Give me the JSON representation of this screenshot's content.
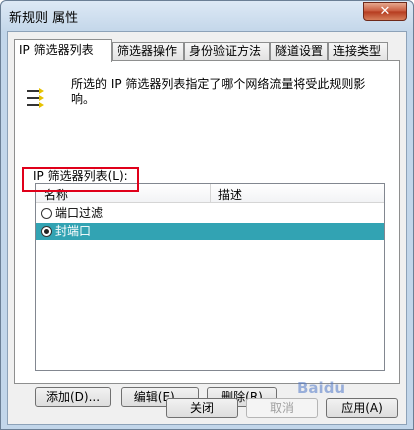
{
  "window": {
    "title": "新规则 属性",
    "close_label": "✕"
  },
  "tabs": [
    {
      "label": "IP 筛选器列表",
      "active": true
    },
    {
      "label": "筛选器操作",
      "active": false
    },
    {
      "label": "身份验证方法",
      "active": false
    },
    {
      "label": "隧道设置",
      "active": false
    },
    {
      "label": "连接类型",
      "active": false
    }
  ],
  "panel": {
    "icon": "filter-list-icon",
    "description": "所选的 IP 筛选器列表指定了哪个网络流量将受此规则影响。",
    "list_label": "IP 筛选器列表(L):"
  },
  "listview": {
    "columns": [
      "名称",
      "描述"
    ],
    "rows": [
      {
        "name": "端口过滤",
        "description": "",
        "checked": false,
        "selected": false
      },
      {
        "name": "封端口",
        "description": "",
        "checked": true,
        "selected": true
      }
    ],
    "selected_color": "#32a3b3"
  },
  "panel_buttons": {
    "add": "添加(D)...",
    "edit": "编辑(E)...",
    "delete": "删除(R)"
  },
  "dialog_buttons": {
    "close": "关闭",
    "cancel": "取消",
    "apply": "应用(A)"
  },
  "watermark": "Baidu"
}
